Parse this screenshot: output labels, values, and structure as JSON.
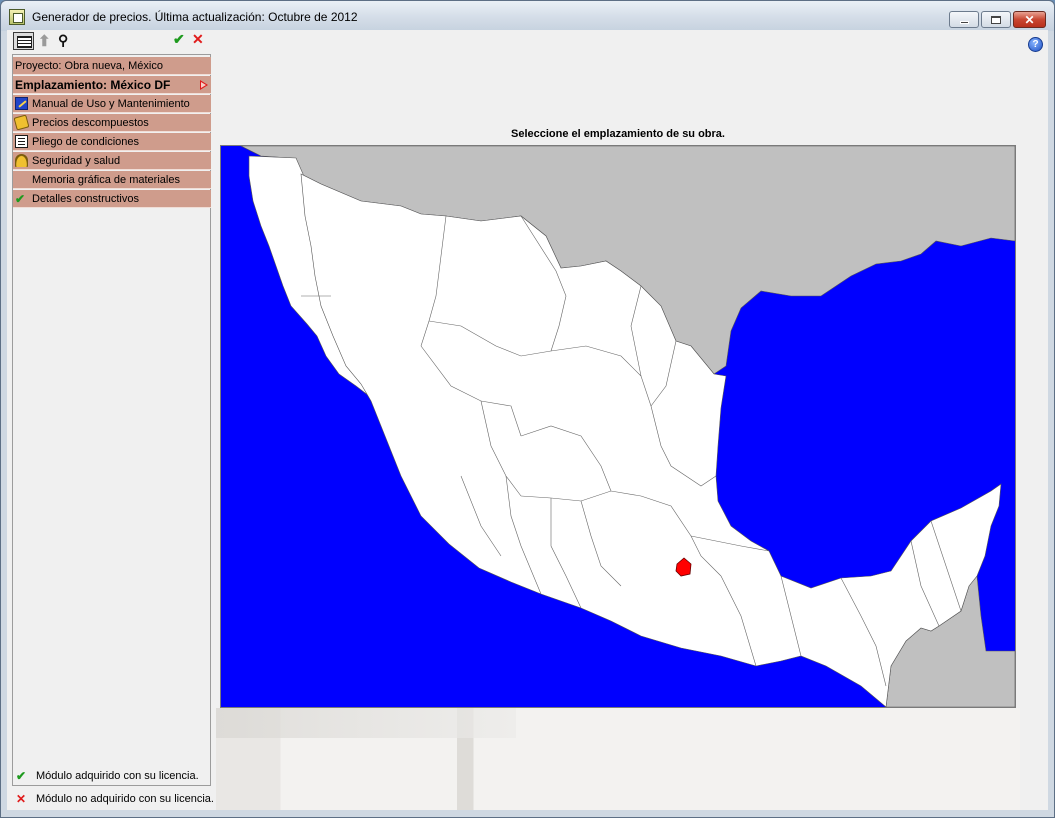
{
  "window": {
    "title": "Generador de precios. Última actualización: Octubre de 2012",
    "controls": [
      "minimize",
      "maximize",
      "close"
    ]
  },
  "toolbar": {
    "icons": [
      "list-view-icon",
      "up-arrow-icon",
      "binoculars-icon",
      "check-icon",
      "cross-icon"
    ]
  },
  "sidebar": {
    "project": "Proyecto: Obra nueva, México",
    "location": "Emplazamiento: México DF",
    "items": [
      {
        "label": "Manual de Uso y Mantenimiento",
        "icon": "wrench-icon"
      },
      {
        "label": "Precios descompuestos",
        "icon": "price-tag-icon"
      },
      {
        "label": "Pliego de condiciones",
        "icon": "document-icon"
      },
      {
        "label": "Seguridad y salud",
        "icon": "hard-hat-icon"
      },
      {
        "label": "Memoria gráfica de materiales",
        "icon": ""
      },
      {
        "label": "Detalles constructivos",
        "icon": "check-icon"
      }
    ]
  },
  "legend": {
    "acquired": "Módulo adquirido con su licencia.",
    "not_acquired": "Módulo no adquirido con su licencia."
  },
  "map": {
    "title": "Seleccione el emplazamiento de su obra.",
    "selected_region": "México DF",
    "colors": {
      "sea": "#0000ff",
      "land": "#ffffff",
      "neighbor": "#c0c0c0",
      "selected": "#ff0000"
    }
  }
}
